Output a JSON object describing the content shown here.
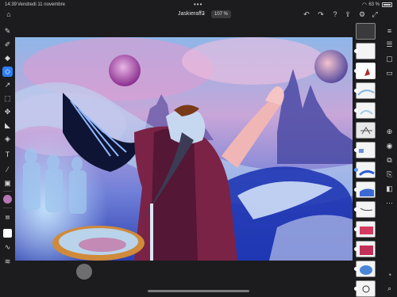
{
  "status": {
    "time": "14:39",
    "date": "Vendredi 11 novembre",
    "dots": "•••",
    "battery_pct": "63 %"
  },
  "toolbar": {
    "doc_title": "Jaskieraff3",
    "zoom": "107 %"
  },
  "colors": {
    "accent": "#2d7ff9",
    "active_color": "#b777b7",
    "background": "#1c1c1e"
  },
  "left_tools": [
    {
      "icon": "brush-icon"
    },
    {
      "icon": "pencil-icon"
    },
    {
      "icon": "fill-icon"
    },
    {
      "icon": "eraser-icon"
    },
    {
      "icon": "smudge-icon"
    },
    {
      "icon": "selection-icon"
    },
    {
      "icon": "transform-icon"
    },
    {
      "icon": "liquify-icon"
    },
    {
      "icon": "shape-icon"
    },
    {
      "icon": "text-icon"
    },
    {
      "icon": "eyedropper-icon"
    },
    {
      "icon": "image-icon"
    }
  ],
  "layers": {
    "count": 14,
    "selected_index": 3
  }
}
